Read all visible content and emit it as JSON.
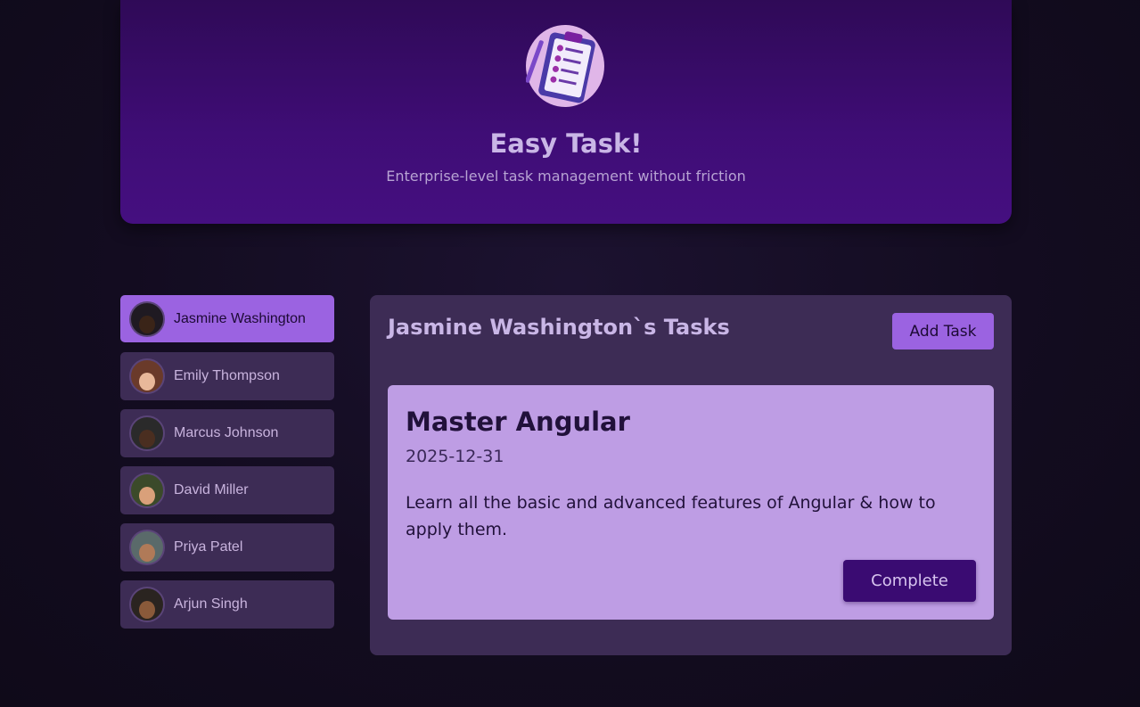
{
  "header": {
    "title": "Easy Task!",
    "subtitle": "Enterprise-level task management without friction",
    "logo_icon": "clipboard-checklist-icon"
  },
  "users": [
    {
      "name": "Jasmine Washington",
      "active": true,
      "skin": "#3a2418",
      "bg": "#1f1a22"
    },
    {
      "name": "Emily Thompson",
      "active": false,
      "skin": "#e8b89a",
      "bg": "#6a3a2a"
    },
    {
      "name": "Marcus Johnson",
      "active": false,
      "skin": "#4a2e20",
      "bg": "#2a2a2a"
    },
    {
      "name": "David Miller",
      "active": false,
      "skin": "#d9a07a",
      "bg": "#3b4a2a"
    },
    {
      "name": "Priya Patel",
      "active": false,
      "skin": "#b07a58",
      "bg": "#5a6a6a"
    },
    {
      "name": "Arjun Singh",
      "active": false,
      "skin": "#8a5a3a",
      "bg": "#2a2420"
    }
  ],
  "tasks_panel": {
    "title": "Jasmine Washington`s Tasks",
    "add_task_label": "Add Task"
  },
  "task": {
    "title": "Master Angular",
    "date": "2025-12-31",
    "description": "Learn all the basic and advanced features of Angular & how to apply them.",
    "complete_label": "Complete"
  },
  "colors": {
    "accent": "#9b63e1",
    "header_bg": "#3f0d76",
    "panel_bg": "#3d2c55",
    "card_bg": "#be9de4",
    "complete_bg": "#3a0b72"
  }
}
